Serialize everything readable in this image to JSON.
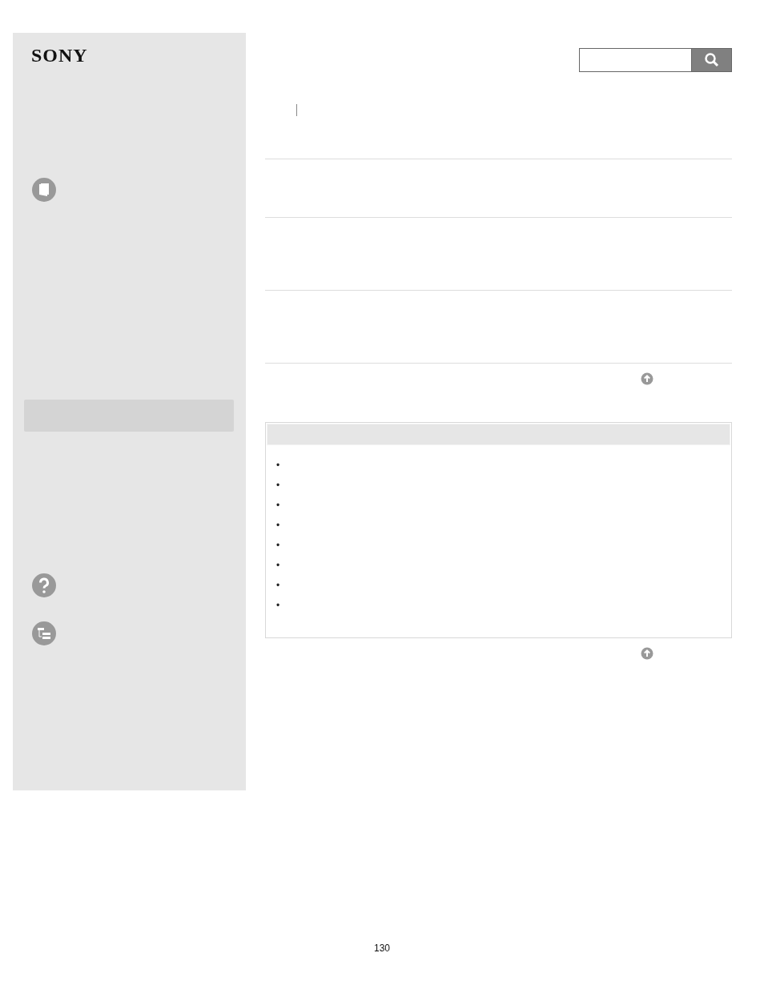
{
  "logo": "SONY",
  "related": {
    "bullets": [
      "•",
      "•",
      "•",
      "•",
      "•",
      "•",
      "•",
      "•"
    ]
  },
  "page_number": "130"
}
